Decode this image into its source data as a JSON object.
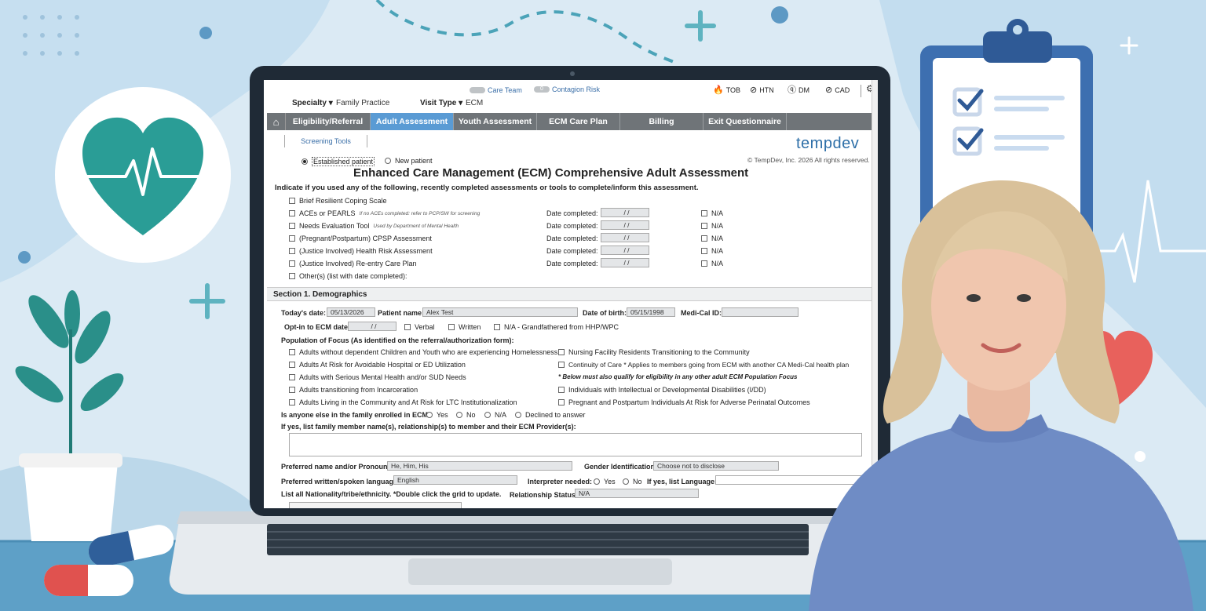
{
  "colors": {
    "accent": "#5a9bd4",
    "navbar": "#6f7478",
    "heart": "#2a9d96",
    "brand": "#2e6fa8"
  },
  "header": {
    "care_team": "Care Team",
    "contagion_count": "0",
    "contagion_risk": "Contagion Risk",
    "specialty_label": "Specialty ▾",
    "specialty_value": "Family Practice",
    "visit_type_label": "Visit Type ▾",
    "visit_type_value": "ECM",
    "indicators": [
      {
        "icon": "flame-icon",
        "label": "TOB"
      },
      {
        "icon": "no-icon",
        "label": "HTN"
      },
      {
        "icon": "question-icon",
        "label": "DM"
      },
      {
        "icon": "no-icon",
        "label": "CAD"
      }
    ]
  },
  "nav": {
    "tabs": [
      "Eligibility/Referral",
      "Adult Assessment",
      "Youth Assessment",
      "ECM Care Plan",
      "Billing",
      "Exit Questionnaire"
    ],
    "active": "Adult Assessment"
  },
  "subtab": "Screening Tools",
  "brand": {
    "logo": "tempdev",
    "copyright": "© TempDev, Inc. 2026 All rights reserved."
  },
  "patient_type": {
    "established": "Established patient",
    "new": "New patient"
  },
  "form": {
    "title": "Enhanced Care Management (ECM) Comprehensive Adult Assessment",
    "instruction": "Indicate if you used any of the following, recently completed assessments or tools to complete/inform this assessment.",
    "tools": [
      {
        "label": "Brief Resilient Coping Scale",
        "note": "",
        "has_date": false
      },
      {
        "label": "ACEs or PEARLS",
        "note": "If no ACEs completed: refer to PCP/SW for screening",
        "has_date": true
      },
      {
        "label": "Needs Evaluation Tool",
        "note": "Used by Department of Mental Health",
        "has_date": true
      },
      {
        "label": "(Pregnant/Postpartum) CPSP Assessment",
        "note": "",
        "has_date": true
      },
      {
        "label": "(Justice Involved) Health Risk Assessment",
        "note": "",
        "has_date": true
      },
      {
        "label": "(Justice Involved) Re-entry Care Plan",
        "note": "",
        "has_date": true
      },
      {
        "label": "Other(s) (list with date completed):",
        "note": "",
        "has_date": false
      }
    ],
    "date_completed_label": "Date completed:",
    "date_placeholder": "/ /",
    "na_label": "N/A"
  },
  "section1": {
    "title": "Section 1. Demographics",
    "todays_date_label": "Today's date:",
    "todays_date": "05/13/2026",
    "patient_name_label": "Patient name:",
    "patient_name": "Alex Test",
    "dob_label": "Date of birth:",
    "dob": "05/15/1998",
    "medical_id_label": "Medi-Cal ID:",
    "medical_id": "",
    "optin_label": "Opt-in to ECM date:",
    "optin_date": "/ /",
    "optin_options": [
      "Verbal",
      "Written",
      "N/A - Grandfathered from HHP/WPC"
    ],
    "pof_label": "Population of Focus (As identified on the referral/authorization form):",
    "pof_left": [
      "Adults without dependent Children and Youth who are experiencing Homelessness",
      "Adults At Risk for Avoidable Hospital or ED Utilization",
      "Adults with Serious Mental Health and/or SUD Needs",
      "Adults transitioning from Incarceration",
      "Adults Living in the Community and At Risk for LTC Institutionalization"
    ],
    "pof_right": [
      "Nursing Facility Residents Transitioning to the Community",
      "Continuity of Care * Applies to members going from ECM with another CA Medi-Cal health plan",
      "* Below must also qualify for eligibility in any other adult ECM Population Focus",
      "Individuals with Intellectual or Developmental Disabilities (I/DD)",
      "Pregnant and Postpartum Individuals At Risk for Adverse Perinatal Outcomes"
    ],
    "family_label": "Is anyone else in the family enrolled in ECM?",
    "family_options": [
      "Yes",
      "No",
      "N/A",
      "Declined to answer"
    ],
    "family_list_label": "If yes, list family member name(s), relationship(s) to member and their ECM Provider(s):",
    "pronouns_label": "Preferred name and/or Pronouns:",
    "pronouns": "He, Him, His",
    "gender_label": "Gender Identification:",
    "gender": "Choose not to disclose",
    "language_label": "Preferred written/spoken language:",
    "language": "English",
    "interpreter_label": "Interpreter needed:",
    "interpreter_options": [
      "Yes",
      "No"
    ],
    "interp_lang_label": "If yes, list Language:",
    "nationality_label": "List all Nationality/tribe/ethnicity.  *Double click the grid to update.",
    "relationship_label": "Relationship Status:",
    "relationship": "N/A"
  }
}
